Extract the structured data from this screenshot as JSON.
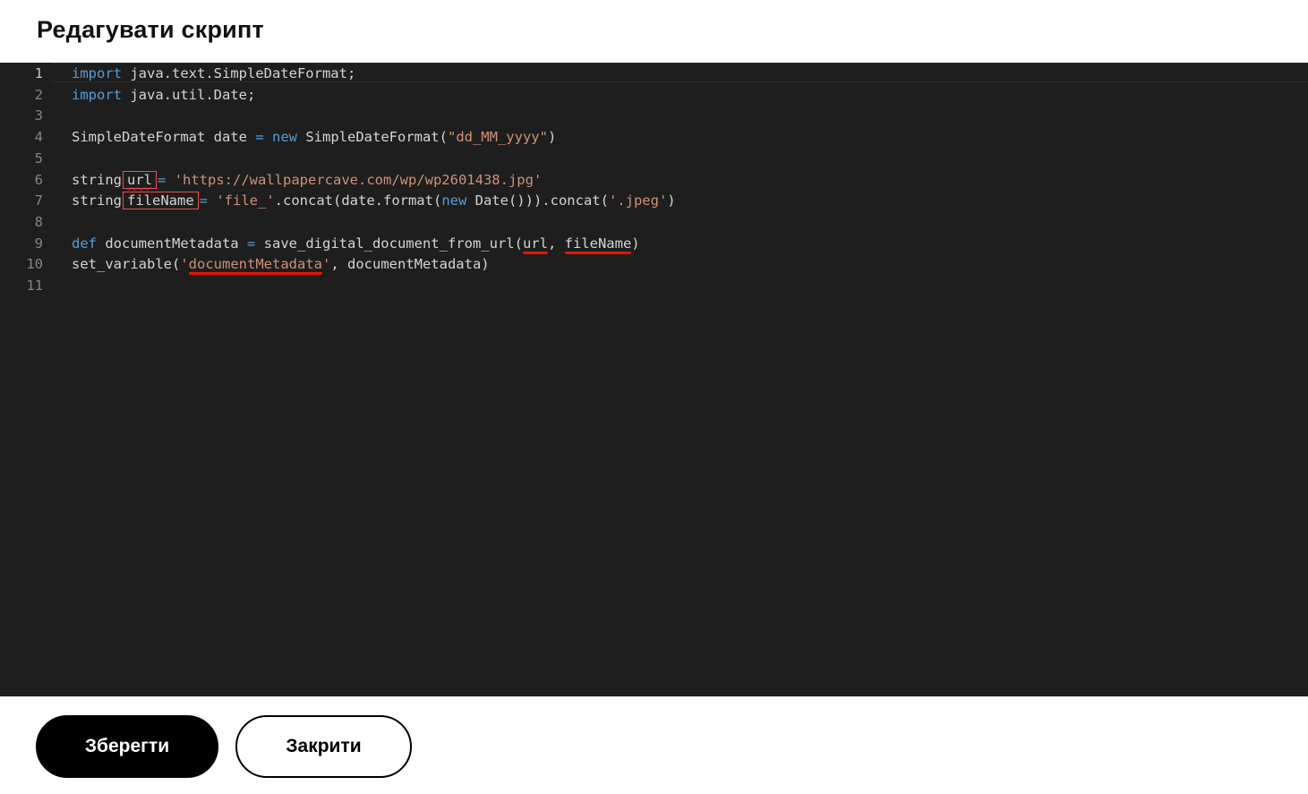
{
  "dialog": {
    "title": "Редагувати скрипт"
  },
  "editor": {
    "lines": [
      {
        "n": "1",
        "tokens": [
          {
            "t": "kw",
            "v": "import"
          },
          {
            "t": "plain",
            "v": " java.text.SimpleDateFormat;"
          }
        ]
      },
      {
        "n": "2",
        "tokens": [
          {
            "t": "kw",
            "v": "import"
          },
          {
            "t": "plain",
            "v": " java.util.Date;"
          }
        ]
      },
      {
        "n": "3",
        "tokens": []
      },
      {
        "n": "4",
        "tokens": [
          {
            "t": "plain",
            "v": "SimpleDateFormat date "
          },
          {
            "t": "op",
            "v": "="
          },
          {
            "t": "plain",
            "v": " "
          },
          {
            "t": "kw",
            "v": "new"
          },
          {
            "t": "plain",
            "v": " SimpleDateFormat("
          },
          {
            "t": "str",
            "v": "\"dd_MM_yyyy\""
          },
          {
            "t": "plain",
            "v": ")"
          }
        ]
      },
      {
        "n": "5",
        "tokens": []
      },
      {
        "n": "6",
        "tokens": [
          {
            "t": "plain",
            "v": "string"
          },
          {
            "t": "boxed-squiggle",
            "v": "url"
          },
          {
            "t": "op",
            "v": "="
          },
          {
            "t": "plain",
            "v": " "
          },
          {
            "t": "str",
            "v": "'https://wallpapercave.com/wp/wp2601438.jpg'"
          }
        ]
      },
      {
        "n": "7",
        "tokens": [
          {
            "t": "plain",
            "v": "string"
          },
          {
            "t": "boxed",
            "v": "fileName"
          },
          {
            "t": "op",
            "v": "="
          },
          {
            "t": "plain",
            "v": " "
          },
          {
            "t": "str",
            "v": "'file_'"
          },
          {
            "t": "plain",
            "v": ".concat(date.format("
          },
          {
            "t": "kw",
            "v": "new"
          },
          {
            "t": "plain",
            "v": " Date())).concat("
          },
          {
            "t": "str",
            "v": "'.jpeg'"
          },
          {
            "t": "plain",
            "v": ")"
          }
        ]
      },
      {
        "n": "8",
        "tokens": []
      },
      {
        "n": "9",
        "tokens": [
          {
            "t": "kw",
            "v": "def"
          },
          {
            "t": "plain",
            "v": " documentMetadata "
          },
          {
            "t": "op",
            "v": "="
          },
          {
            "t": "plain",
            "v": " save_digital_document_from_url("
          },
          {
            "t": "under",
            "v": "url"
          },
          {
            "t": "plain",
            "v": ", "
          },
          {
            "t": "under",
            "v": "fileName"
          },
          {
            "t": "plain",
            "v": ")"
          }
        ]
      },
      {
        "n": "10",
        "tokens": [
          {
            "t": "plain",
            "v": "set_variable("
          },
          {
            "t": "str",
            "v": "'"
          },
          {
            "t": "str-under",
            "v": "documentMetadata"
          },
          {
            "t": "str",
            "v": "'"
          },
          {
            "t": "plain",
            "v": ", documentMetadata)"
          }
        ]
      },
      {
        "n": "11",
        "tokens": []
      }
    ]
  },
  "footer": {
    "save_label": "Зберегти",
    "close_label": "Закрити"
  },
  "colors": {
    "editor_bg": "#1e1e1e",
    "keyword": "#569cd6",
    "string": "#ce9178",
    "error": "#e51400",
    "primary_button": "#000000"
  }
}
